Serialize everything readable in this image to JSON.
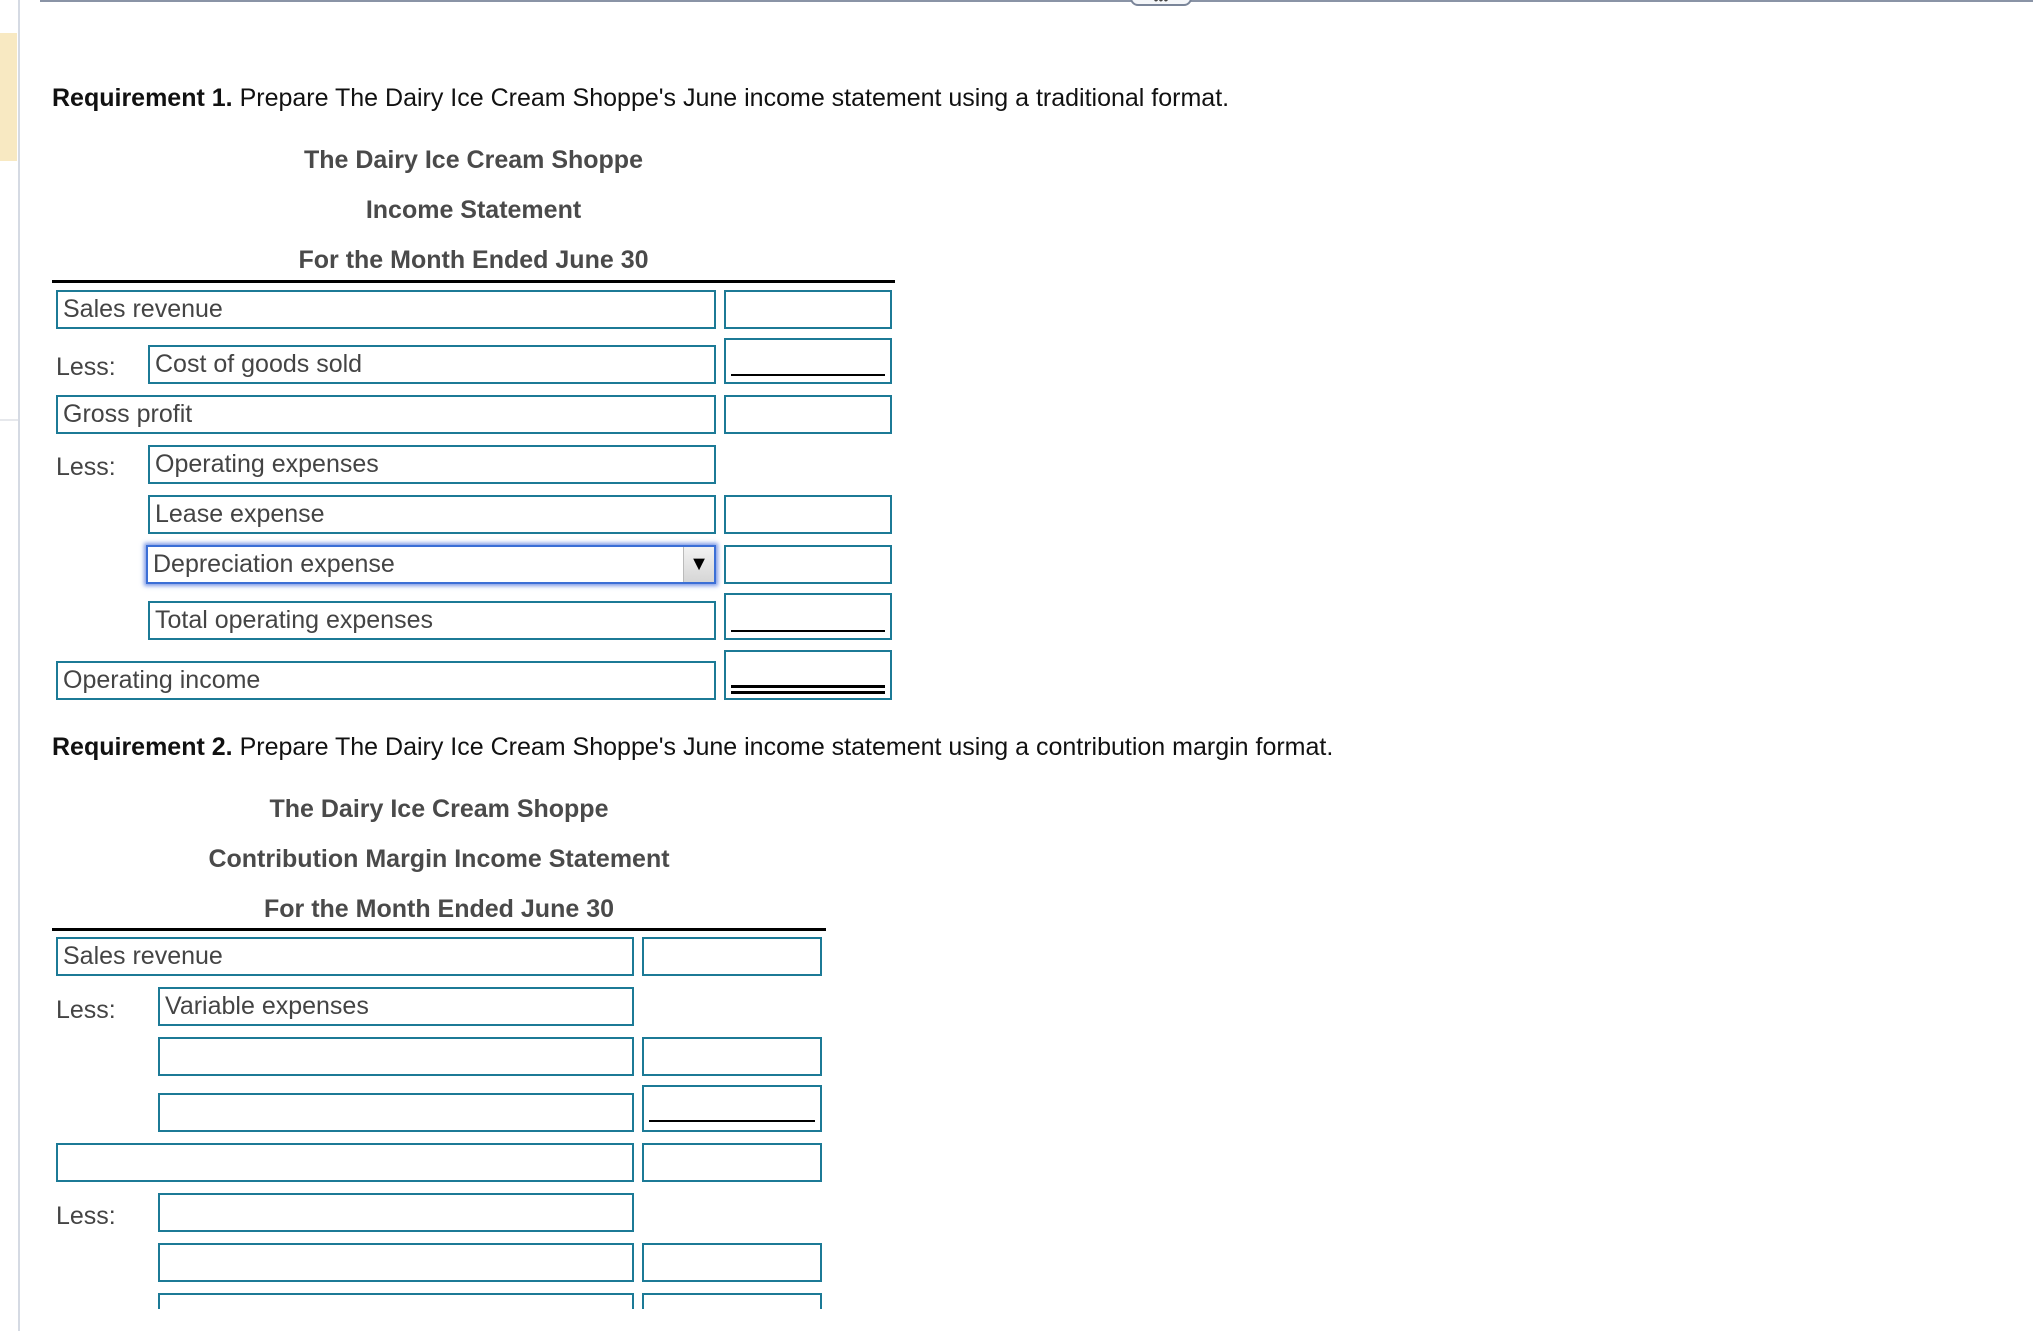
{
  "toolbar": {
    "handle_label": "•••"
  },
  "requirement1": {
    "label": "Requirement 1.",
    "text": "Prepare The Dairy Ice Cream Shoppe's June income statement using a traditional format.",
    "company": "The Dairy Ice Cream Shoppe",
    "statement": "Income Statement",
    "period": "For the Month Ended June 30",
    "less_label": "Less:",
    "rows": {
      "sales_revenue": {
        "label": "Sales revenue",
        "amount": ""
      },
      "cost_of_goods_sold": {
        "label": "Cost of goods sold",
        "amount": ""
      },
      "gross_profit": {
        "label": "Gross profit",
        "amount": ""
      },
      "operating_expenses": {
        "label": "Operating expenses"
      },
      "lease_expense": {
        "label": "Lease expense",
        "amount": ""
      },
      "depreciation_expense": {
        "label": "Depreciation expense",
        "amount": "",
        "dropdown_icon": "▼"
      },
      "total_operating_expenses": {
        "label": "Total operating expenses",
        "amount": ""
      },
      "operating_income": {
        "label": "Operating income",
        "amount": ""
      }
    }
  },
  "requirement2": {
    "label": "Requirement 2.",
    "text": "Prepare The Dairy Ice Cream Shoppe's June income statement using a contribution margin format.",
    "company": "The Dairy Ice Cream Shoppe",
    "statement": "Contribution Margin Income Statement",
    "period": "For the Month Ended June 30",
    "less_label": "Less:",
    "rows": {
      "sales_revenue": {
        "label": "Sales revenue",
        "amount": ""
      },
      "variable_expenses": {
        "label": "Variable expenses"
      },
      "row3": {
        "label": "",
        "amount": ""
      },
      "row4": {
        "label": "",
        "amount": ""
      },
      "row5": {
        "label": "",
        "amount": ""
      },
      "row6": {
        "label": ""
      },
      "row7": {
        "label": "",
        "amount": ""
      },
      "row8": {
        "label": "",
        "amount": ""
      }
    }
  }
}
